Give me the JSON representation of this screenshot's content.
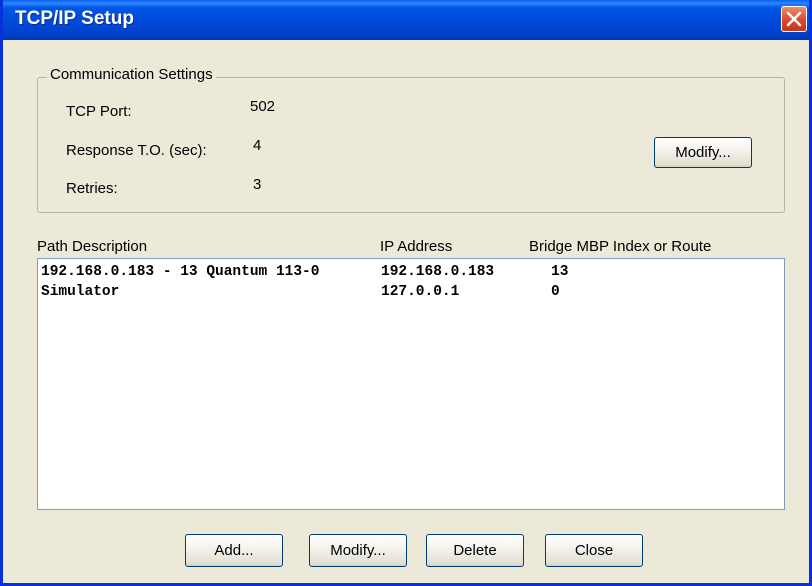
{
  "window": {
    "title": "TCP/IP Setup"
  },
  "comm_settings": {
    "group_label": "Communication Settings",
    "tcp_port_label": "TCP Port:",
    "tcp_port_value": "502",
    "response_label": "Response T.O. (sec):",
    "response_value": "4",
    "retries_label": "Retries:",
    "retries_value": "3",
    "modify_label": "Modify..."
  },
  "paths": {
    "headers": [
      "Path Description",
      "IP Address",
      "Bridge MBP Index or Route"
    ],
    "rows": [
      {
        "description": "192.168.0.183 - 13 Quantum 113-0",
        "ip": "192.168.0.183",
        "bridge": "13"
      },
      {
        "description": "Simulator",
        "ip": "127.0.0.1",
        "bridge": "0"
      }
    ]
  },
  "buttons": {
    "add": "Add...",
    "modify": "Modify...",
    "delete": "Delete",
    "close": "Close"
  },
  "colors": {
    "titlebar": "#0055E5",
    "dialog_bg": "#ECE9D8",
    "close_button": "#D8452B"
  },
  "icons": {
    "close": "close-icon"
  }
}
